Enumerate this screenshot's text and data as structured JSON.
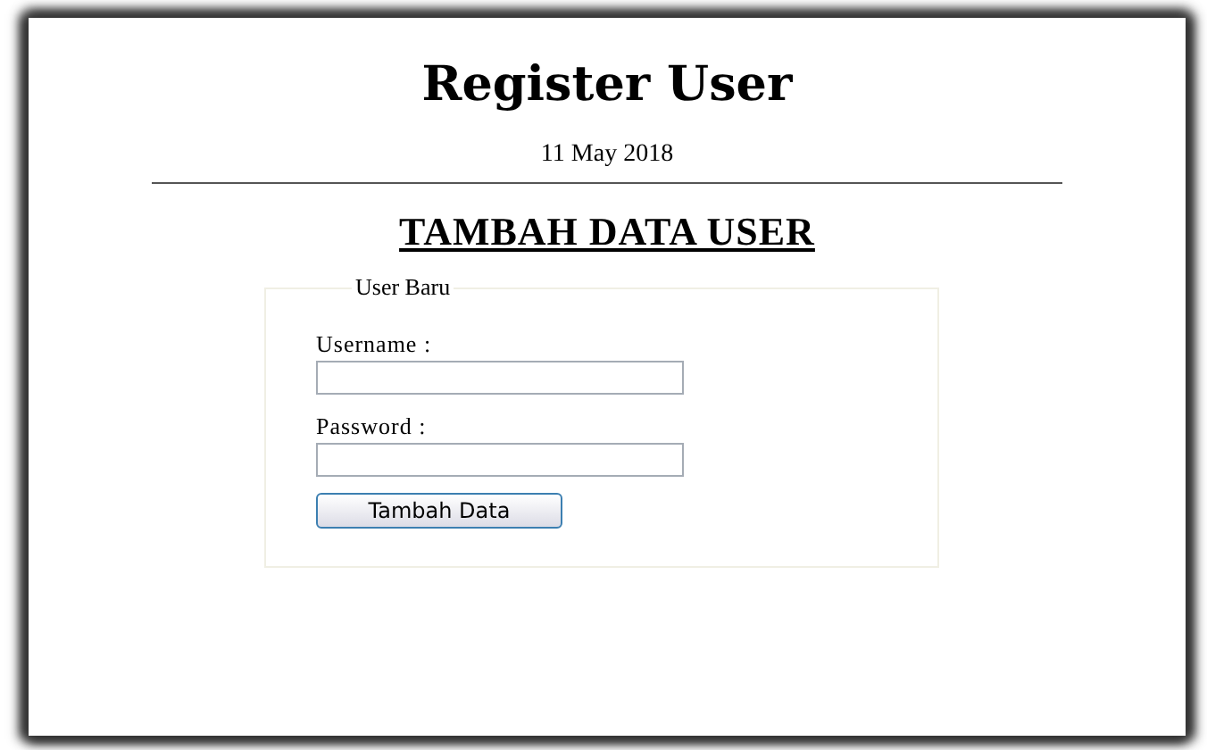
{
  "page": {
    "title": "Register User",
    "date": "11 May 2018",
    "heading": "TAMBAH DATA USER"
  },
  "form": {
    "legend": "User Baru",
    "fields": [
      {
        "label": "Username :"
      },
      {
        "label": "Password :"
      }
    ],
    "button": "Tambah Data"
  }
}
